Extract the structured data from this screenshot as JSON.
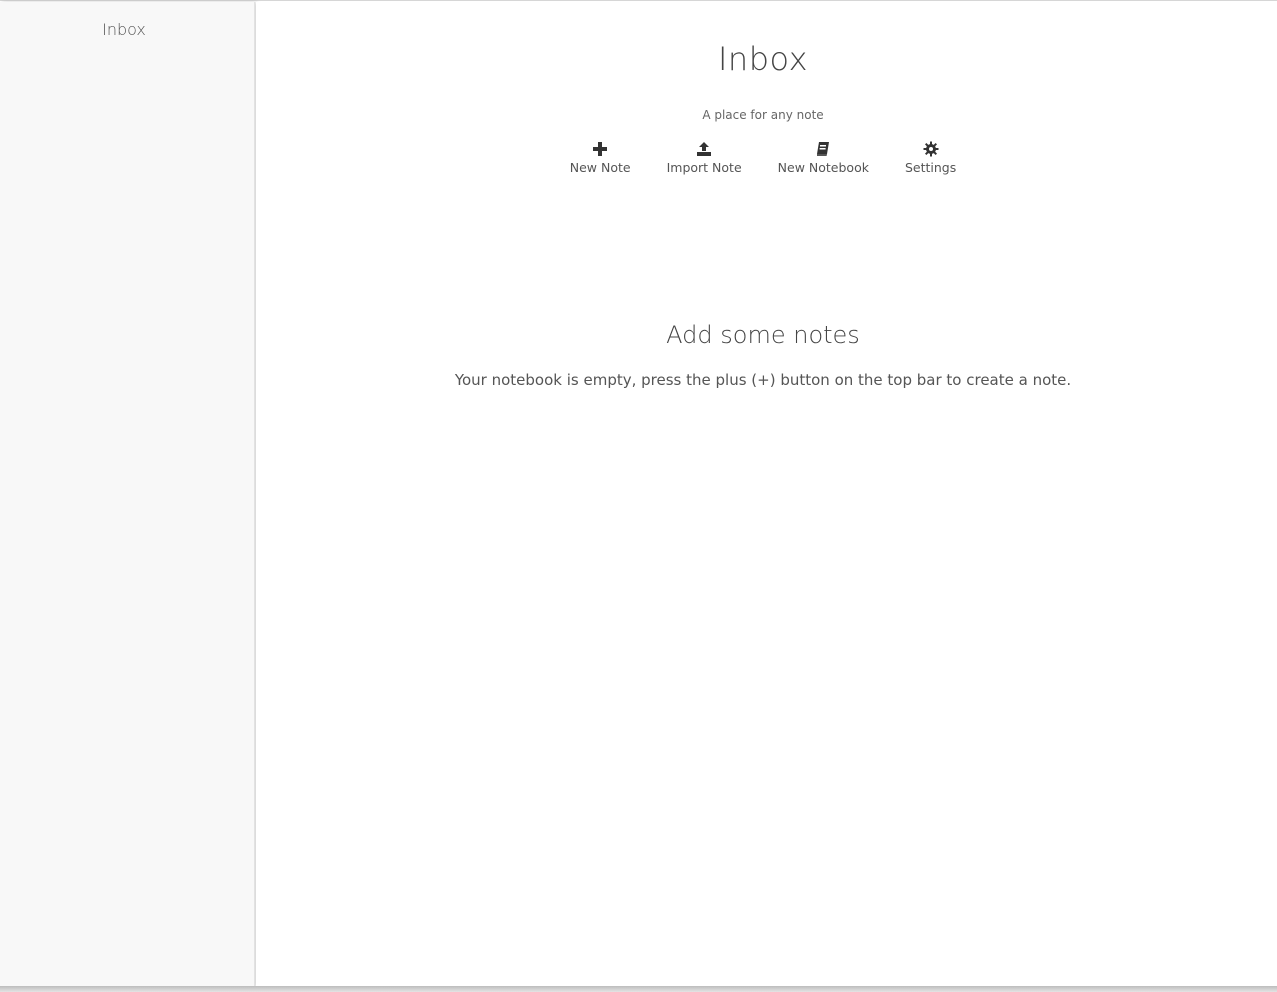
{
  "sidebar": {
    "items": [
      {
        "label": "Inbox"
      }
    ]
  },
  "header": {
    "title": "Inbox",
    "subtitle": "A place for any note"
  },
  "toolbar": {
    "items": [
      {
        "label": "New Note",
        "icon": "plus-icon"
      },
      {
        "label": "Import Note",
        "icon": "upload-icon"
      },
      {
        "label": "New Notebook",
        "icon": "book-icon"
      },
      {
        "label": "Settings",
        "icon": "gear-icon"
      }
    ]
  },
  "empty_state": {
    "title": "Add some notes",
    "description": "Your notebook is empty, press the plus (+) button on the top bar to create a note."
  },
  "colors": {
    "sidebar_bg": "#f8f8f8",
    "text": "#444444",
    "icon": "#333333"
  }
}
